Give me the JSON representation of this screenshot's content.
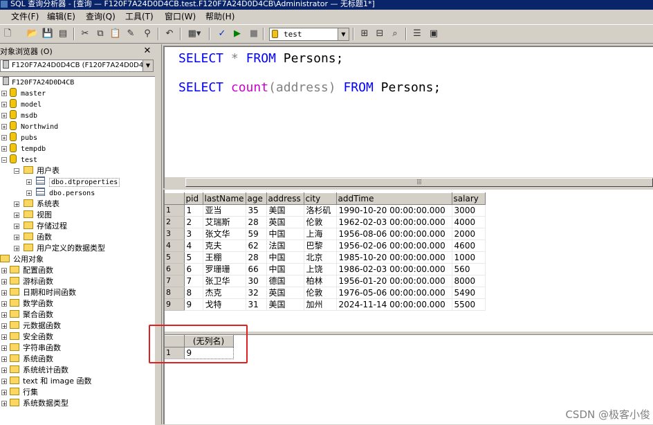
{
  "window": {
    "title": "SQL 查询分析器 - [查询 — F120F7A24D0D4CB.test.F120F7A24D0D4CB\\Administrator — 无标题1*]"
  },
  "menu": [
    "文件(F)",
    "编辑(E)",
    "查询(Q)",
    "工具(T)",
    "窗口(W)",
    "帮助(H)"
  ],
  "toolbar": {
    "database": "test"
  },
  "object_browser": {
    "title": "对象浏览器 (O)",
    "server_select": "F120F7A24D0D4CB (F120F7A24D0D4CB\\",
    "server": "F120F7A24D0D4CB",
    "databases": [
      "master",
      "model",
      "msdb",
      "Northwind",
      "pubs",
      "tempdb",
      "test"
    ],
    "user_tables_label": "用户表",
    "user_tables": [
      "dbo.dtproperties",
      "dbo.persons"
    ],
    "test_children": [
      "系统表",
      "视图",
      "存储过程",
      "函数",
      "用户定义的数据类型"
    ],
    "public_objects_label": "公用对象",
    "public_objects": [
      "配置函数",
      "游标函数",
      "日期和时间函数",
      "数学函数",
      "聚合函数",
      "元数据函数",
      "安全函数",
      "字符串函数",
      "系统函数",
      "系统统计函数",
      "text 和 image 函数",
      "行集",
      "系统数据类型"
    ]
  },
  "editor": {
    "line1": {
      "kw1": "SELECT",
      "star": "*",
      "kw2": "FROM",
      "table": "Persons;"
    },
    "line2": {
      "kw1": "SELECT",
      "fn": "count",
      "arg": "(address)",
      "kw2": "FROM",
      "table": "Persons;"
    }
  },
  "results1": {
    "columns": [
      "pid",
      "lastName",
      "age",
      "address",
      "city",
      "addTime",
      "salary"
    ],
    "rows": [
      [
        "1",
        "1",
        "亚当",
        "35",
        "美国",
        "洛杉矶",
        "1990-10-20 00:00:00.000",
        "3000"
      ],
      [
        "2",
        "2",
        "艾瑞斯",
        "28",
        "英国",
        "伦敦",
        "1962-02-03 00:00:00.000",
        "4000"
      ],
      [
        "3",
        "3",
        "张文华",
        "59",
        "中国",
        "上海",
        "1956-08-06 00:00:00.000",
        "2000"
      ],
      [
        "4",
        "4",
        "克夫",
        "62",
        "法国",
        "巴黎",
        "1956-02-06 00:00:00.000",
        "4600"
      ],
      [
        "5",
        "5",
        "王棚",
        "28",
        "中国",
        "北京",
        "1985-10-20 00:00:00.000",
        "1000"
      ],
      [
        "6",
        "6",
        "罗珊珊",
        "66",
        "中国",
        "上饶",
        "1986-02-03 00:00:00.000",
        "560"
      ],
      [
        "7",
        "7",
        "张卫华",
        "30",
        "德国",
        "柏林",
        "1956-01-20 00:00:00.000",
        "8000"
      ],
      [
        "8",
        "8",
        "杰克",
        "32",
        "英国",
        "伦敦",
        "1976-05-06 00:00:00.000",
        "5490"
      ],
      [
        "9",
        "9",
        "戈特",
        "31",
        "美国",
        "加州",
        "2024-11-14 00:00:00.000",
        "5500"
      ]
    ]
  },
  "results2": {
    "column": "(无列名)",
    "row_number": "1",
    "value": "9"
  },
  "watermark": "CSDN @极客小俊"
}
